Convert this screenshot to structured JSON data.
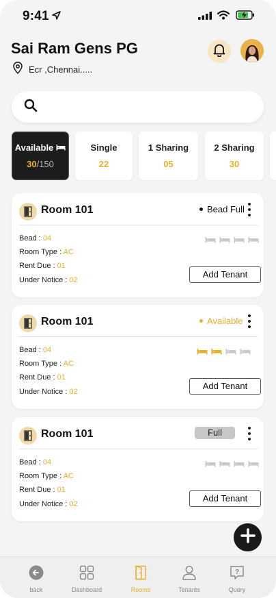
{
  "status_bar": {
    "time": "9:41"
  },
  "header": {
    "title": "Sai Ram Gens PG",
    "location": "Ecr ,Chennai.....",
    "notification_icon": "bell-icon",
    "avatar_icon": "user-avatar"
  },
  "search": {
    "placeholder": "",
    "value": "",
    "icon": "search-icon"
  },
  "filters": [
    {
      "label": "Available",
      "count": "30",
      "total": "/150",
      "active": true,
      "icon": "bed-icon"
    },
    {
      "label": "Single",
      "count": "22"
    },
    {
      "label": "1 Sharing",
      "count": "05"
    },
    {
      "label": "2 Sharing",
      "count": "30"
    }
  ],
  "rooms": [
    {
      "name": "Room 101",
      "status": "Bead Full",
      "status_color": "#111111",
      "bead_label": "Bead : ",
      "bead": "04",
      "type_label": "Room Type : ",
      "type": "AC",
      "rent_label": "Rent Due : ",
      "rent_due": "01",
      "notice_label": "Under Notice : ",
      "notice": "02",
      "beds_occupied": 0,
      "add_label": "Add Tenant"
    },
    {
      "name": "Room 101",
      "status": "Available",
      "status_color": "#e6b028",
      "bead_label": "Bead : ",
      "bead": "04",
      "type_label": "Room Type : ",
      "type": "AC",
      "rent_label": "Rent Due : ",
      "rent_due": "01",
      "notice_label": "Under Notice : ",
      "notice": "02",
      "beds_occupied": 2,
      "add_label": "Add Tenant"
    },
    {
      "name": "Room 101",
      "status": "Full",
      "status_color": "#c7c7c7",
      "bead_label": "Bead : ",
      "bead": "04",
      "type_label": "Room Type : ",
      "type": "AC",
      "rent_label": "Rent Due : ",
      "rent_due": "01",
      "notice_label": "Under Notice : ",
      "notice": "02",
      "beds_occupied": 0,
      "add_label": "Add Tenant"
    }
  ],
  "nav": [
    {
      "label": "back",
      "icon": "back-arrow-icon"
    },
    {
      "label": "Dashboard",
      "icon": "dashboard-grid-icon"
    },
    {
      "label": "Rooms",
      "icon": "door-icon",
      "active": true
    },
    {
      "label": "Tenants",
      "icon": "person-icon"
    },
    {
      "label": "Query",
      "icon": "help-icon"
    }
  ],
  "colors": {
    "accent": "#e6b028",
    "dark": "#1c1c1c",
    "background": "#f4f4f4"
  }
}
